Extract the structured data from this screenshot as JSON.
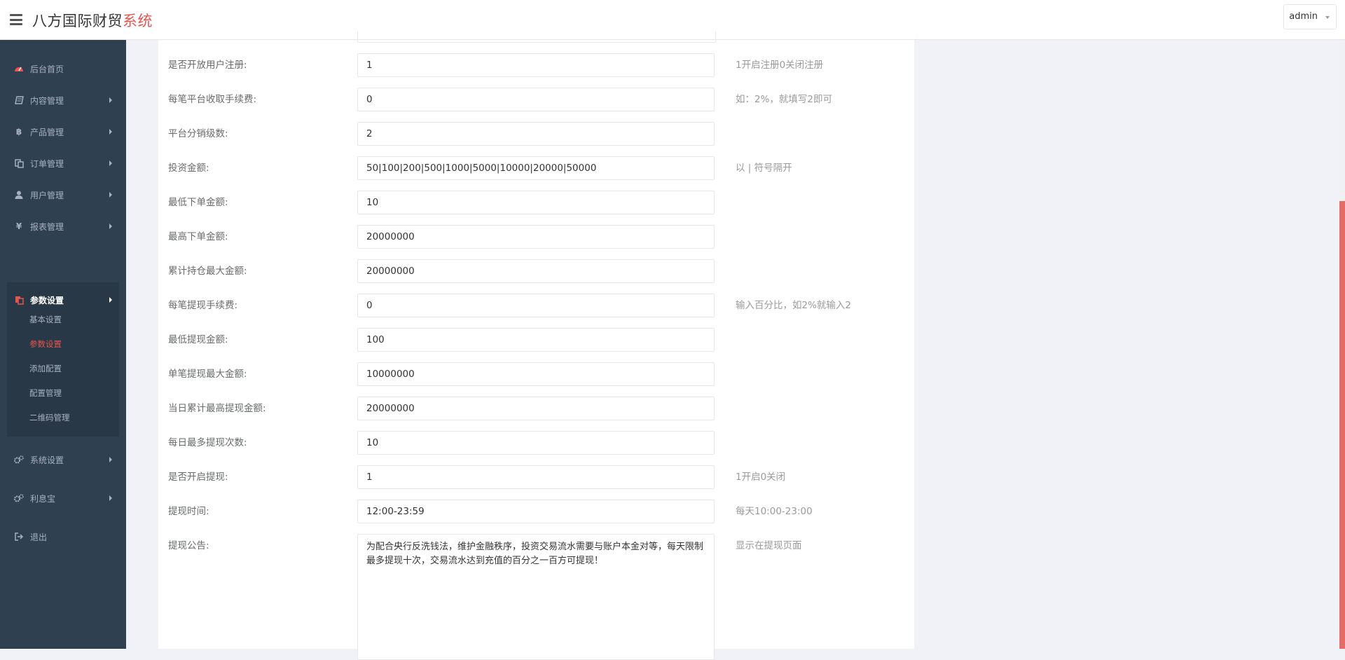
{
  "header": {
    "brand_main": "八方国际财贸",
    "brand_accent": "系统",
    "user_label": "admin"
  },
  "sidebar": {
    "items": [
      {
        "label": "后台首页",
        "icon": "dashboard-icon"
      },
      {
        "label": "内容管理",
        "icon": "book-icon"
      },
      {
        "label": "产品管理",
        "icon": "bitcoin-icon"
      },
      {
        "label": "订单管理",
        "icon": "copy-icon"
      },
      {
        "label": "用户管理",
        "icon": "user-icon"
      },
      {
        "label": "报表管理",
        "icon": "yen-icon"
      },
      {
        "label": "参数设置",
        "icon": "files-icon"
      },
      {
        "label": "系统设置",
        "icon": "cogs-icon"
      },
      {
        "label": "利息宝",
        "icon": "cogs-icon"
      },
      {
        "label": "退出",
        "icon": "sign-out-icon"
      }
    ],
    "sub_items": [
      "基本设置",
      "参数设置",
      "添加配置",
      "配置管理",
      "二维码管理"
    ],
    "active_sub": "参数设置"
  },
  "form": {
    "rows": [
      {
        "label": "是否开放用户注册:",
        "value": "1",
        "hint": "1开启注册0关闭注册"
      },
      {
        "label": "每笔平台收取手续费:",
        "value": "0",
        "hint": "如：2%，就填写2即可"
      },
      {
        "label": "平台分销级数:",
        "value": "2",
        "hint": ""
      },
      {
        "label": "投资金额:",
        "value": "50|100|200|500|1000|5000|10000|20000|50000",
        "hint": "以 | 符号隔开"
      },
      {
        "label": "最低下单金额:",
        "value": "10",
        "hint": ""
      },
      {
        "label": "最高下单金额:",
        "value": "20000000",
        "hint": ""
      },
      {
        "label": "累计持仓最大金额:",
        "value": "20000000",
        "hint": ""
      },
      {
        "label": "每笔提现手续费:",
        "value": "0",
        "hint": "输入百分比，如2%就输入2"
      },
      {
        "label": "最低提现金额:",
        "value": "100",
        "hint": ""
      },
      {
        "label": "单笔提现最大金额:",
        "value": "10000000",
        "hint": ""
      },
      {
        "label": "当日累计最高提现金额:",
        "value": "20000000",
        "hint": ""
      },
      {
        "label": "每日最多提现次数:",
        "value": "10",
        "hint": ""
      },
      {
        "label": "是否开启提现:",
        "value": "1",
        "hint": "1开启0关闭"
      },
      {
        "label": "提现时间:",
        "value": "12:00-23:59",
        "hint": "每天10:00-23:00"
      }
    ],
    "notice": {
      "label": "提现公告:",
      "value": "为配合央行反洗钱法，维护金融秩序，投资交易流水需要与账户本金对等，每天限制最多提现十次，交易流水达到充值的百分之一百方可提现！",
      "hint": "显示在提现页面"
    }
  },
  "colors": {
    "sidebar_bg": "#2f4050",
    "accent": "#e8554e"
  }
}
